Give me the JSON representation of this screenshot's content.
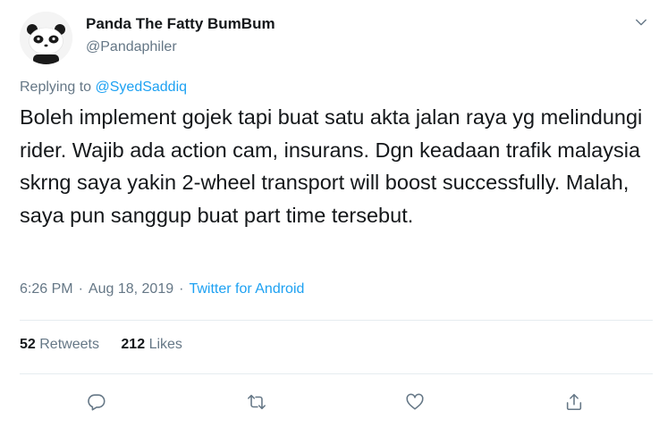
{
  "author": {
    "name": "Panda The Fatty BumBum",
    "handle": "@Pandaphiler",
    "avatar_icon": "panda-avatar"
  },
  "reply": {
    "prefix": "Replying to",
    "to": "@SyedSaddiq"
  },
  "tweet": {
    "text": "Boleh implement gojek tapi buat satu akta jalan raya yg melindungi rider. Wajib ada action cam, insurans. Dgn keadaan trafik malaysia skrng saya yakin 2-wheel transport will boost successfully. Malah, saya pun sanggup buat part time tersebut."
  },
  "meta": {
    "time": "6:26 PM",
    "separator": "·",
    "date": "Aug 18, 2019",
    "source": "Twitter for Android"
  },
  "stats": {
    "retweets_count": "52",
    "retweets_label": "Retweets",
    "likes_count": "212",
    "likes_label": "Likes"
  },
  "actions": [
    {
      "name": "reply",
      "icon": "reply-icon"
    },
    {
      "name": "retweet",
      "icon": "retweet-icon"
    },
    {
      "name": "like",
      "icon": "heart-icon"
    },
    {
      "name": "share",
      "icon": "share-icon"
    }
  ],
  "colors": {
    "link": "#1da1f2",
    "secondary_text": "#657786",
    "primary_text": "#14171a",
    "divider": "#e6ecf0"
  }
}
